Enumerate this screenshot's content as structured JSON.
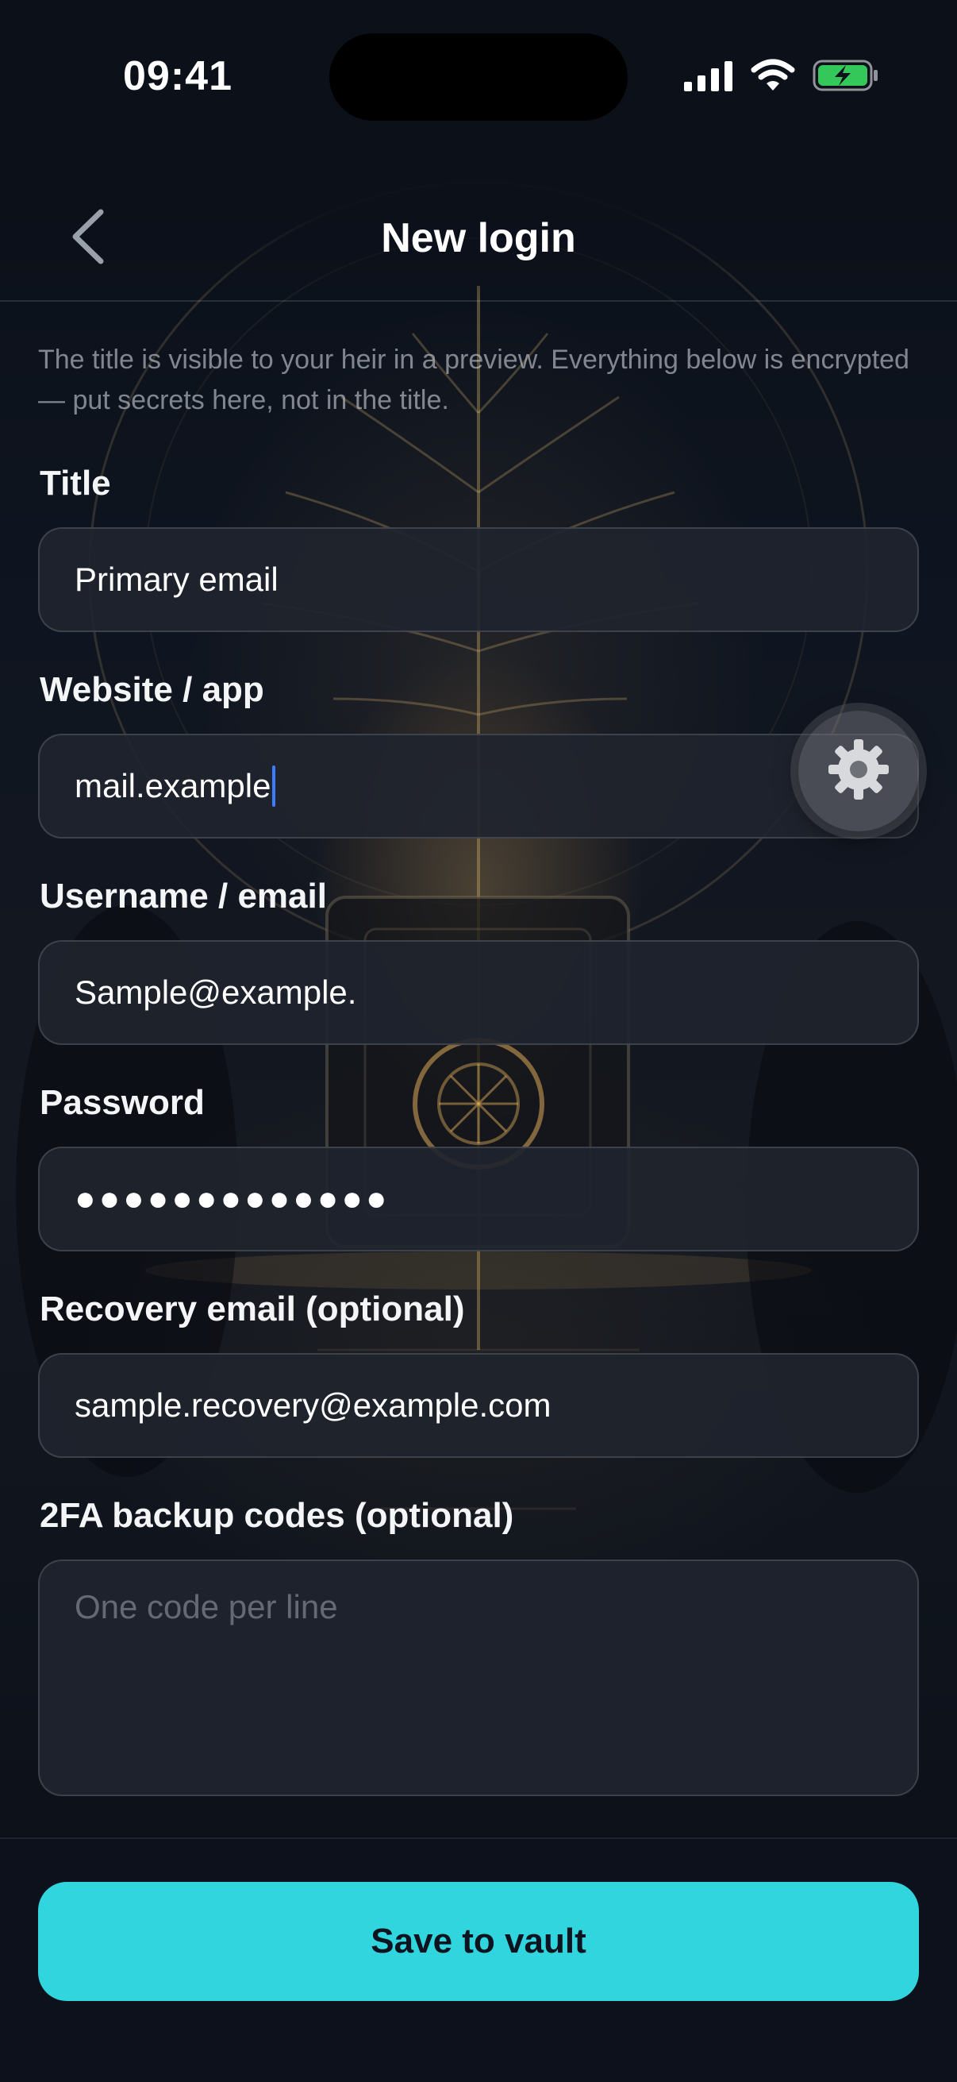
{
  "status_bar": {
    "time": "09:41",
    "icons": [
      "signal-icon",
      "wifi-icon",
      "battery-charging-icon"
    ]
  },
  "nav": {
    "title": "New login",
    "back_icon": "chevron-left-icon"
  },
  "helper_text": "The title is visible to your heir in a preview. Everything below is encrypted — put secrets here, not in the title.",
  "form": {
    "title": {
      "label": "Title",
      "value": "Primary email"
    },
    "website": {
      "label": "Website / app",
      "value": "mail.example"
    },
    "username": {
      "label": "Username / email",
      "value": "Sample@example."
    },
    "password": {
      "label": "Password",
      "value": "●●●●●●●●●●●●●"
    },
    "recovery_email": {
      "label": "Recovery email (optional)",
      "value": "sample.recovery@example.com"
    },
    "backup_codes": {
      "label": "2FA backup codes (optional)",
      "placeholder": "One code per line",
      "value": ""
    }
  },
  "floating_button_icon": "gear-icon",
  "save_button": {
    "label": "Save to vault"
  },
  "colors": {
    "accent": "#30d5de",
    "background": "#0c111b",
    "field_bg": "#20242e",
    "caret": "#3d7bff",
    "battery": "#34c759"
  }
}
